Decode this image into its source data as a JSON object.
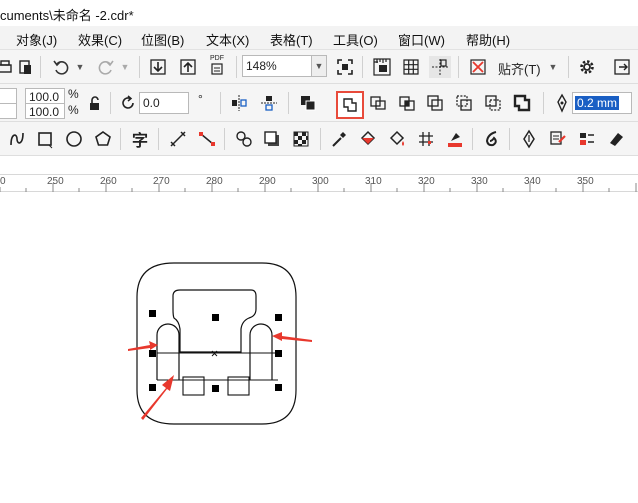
{
  "window": {
    "title": "cuments\\未命名 -2.cdr*"
  },
  "menu": {
    "items": [
      {
        "key": "object",
        "label": "对象(J)"
      },
      {
        "key": "effects",
        "label": "效果(C)"
      },
      {
        "key": "bitmaps",
        "label": "位图(B)"
      },
      {
        "key": "text",
        "label": "文本(X)"
      },
      {
        "key": "table",
        "label": "表格(T)"
      },
      {
        "key": "tools",
        "label": "工具(O)"
      },
      {
        "key": "window",
        "label": "窗口(W)"
      },
      {
        "key": "help",
        "label": "帮助(H)"
      }
    ]
  },
  "toolbar": {
    "zoom_value": "148%",
    "snap_label": "贴齐(T)",
    "pdf_label": "PDF"
  },
  "property_bar": {
    "scale_x": "100.0",
    "scale_y": "100.0",
    "percent": "%",
    "rotation": "0.0",
    "degree": "°",
    "outline_width": "0.2 mm"
  },
  "ruler": {
    "labels": [
      "250",
      "260",
      "270",
      "280",
      "290",
      "300",
      "310",
      "320",
      "330",
      "340",
      "350"
    ]
  },
  "toolbox": {
    "text_tool_glyph": "字"
  },
  "colors": {
    "accent_red": "#e8382d",
    "highlight_box": "#e84a3a",
    "selection_handle": "#000000",
    "field_highlight": "#1a5fc4"
  }
}
